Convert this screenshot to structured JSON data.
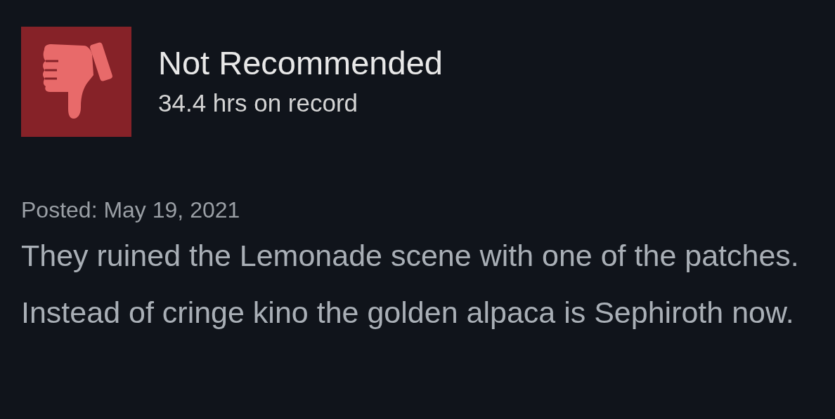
{
  "review": {
    "recommended": false,
    "verdict": "Not Recommended",
    "hours": "34.4 hrs on record",
    "posted": "Posted: May 19, 2021",
    "text": "They ruined the Lemonade scene with one of the patches. Instead of cringe kino the golden alpaca is Sephiroth now."
  }
}
